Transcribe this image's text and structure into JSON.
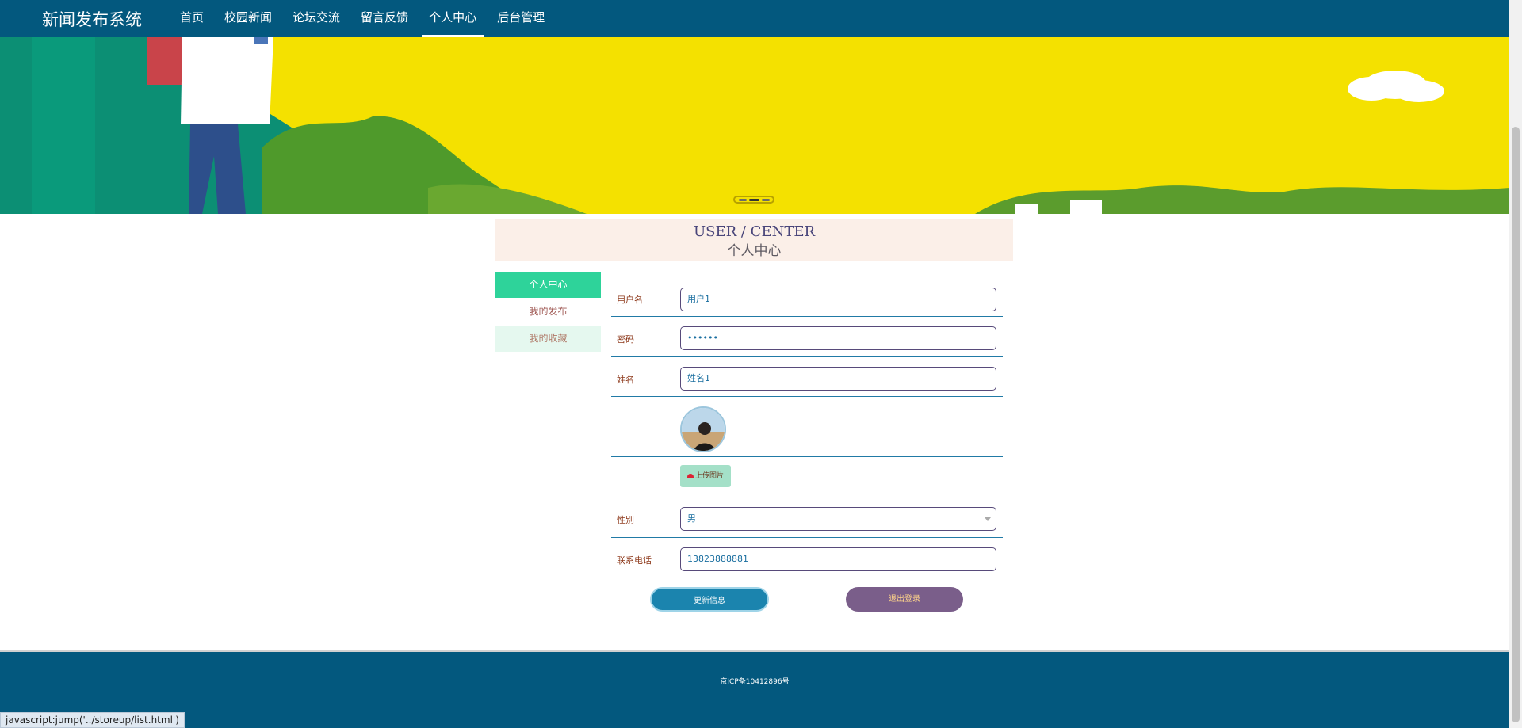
{
  "app": {
    "brand": "新闻发布系统"
  },
  "nav": {
    "items": [
      {
        "label": "首页"
      },
      {
        "label": "校园新闻"
      },
      {
        "label": "论坛交流"
      },
      {
        "label": "留言反馈"
      },
      {
        "label": "个人中心",
        "active": true
      },
      {
        "label": "后台管理"
      }
    ]
  },
  "banner": {
    "slides": 3,
    "active_slide": 2
  },
  "user_center": {
    "title_en": "USER / CENTER",
    "title_zh": "个人中心"
  },
  "side_menu": {
    "items": [
      {
        "label": "个人中心",
        "active": true
      },
      {
        "label": "我的发布"
      },
      {
        "label": "我的收藏"
      }
    ]
  },
  "form": {
    "username": {
      "label": "用户名",
      "value": "用户1"
    },
    "password": {
      "label": "密码",
      "value": "••••••"
    },
    "name": {
      "label": "姓名",
      "value": "姓名1"
    },
    "upload": {
      "label": "上传图片"
    },
    "gender": {
      "label": "性别",
      "value": "男"
    },
    "phone": {
      "label": "联系电话",
      "value": "13823888881"
    }
  },
  "actions": {
    "update": "更新信息",
    "logout": "退出登录"
  },
  "footer": {
    "icp": "京ICP备10412896号"
  },
  "status_bar": {
    "url": "javascript:jump('../storeup/list.html')"
  },
  "colors": {
    "nav_bg": "#03587e",
    "accent_green": "#2ed39a",
    "update_btn": "#1b84ae",
    "logout_btn": "#7a5e8a"
  }
}
